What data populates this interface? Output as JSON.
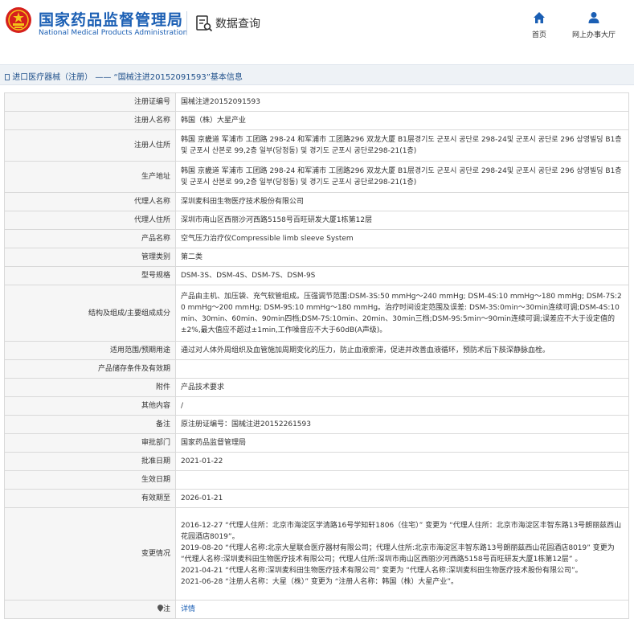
{
  "header": {
    "brand_cn": "国家药品监督管理局",
    "brand_en": "National Medical Products Administration",
    "query_title": "数据查询",
    "nav": {
      "home": "首页",
      "hall": "网上办事大厅"
    }
  },
  "breadcrumb": {
    "section": "进口医疗器械（注册）",
    "sep": " —— ",
    "record": "“国械注进20152091593”基本信息"
  },
  "rows": [
    {
      "key": "注册证编号",
      "value": "国械注进20152091593"
    },
    {
      "key": "注册人名称",
      "value": "韩国（株）大星产业"
    },
    {
      "key": "注册人住所",
      "value": "韩国 京畿道 军浦市 工团路 298-24 和军浦市 工团路296 双龙大厦 B1层경기도 군포시 공단로 298-24및 군포시 공단로 296 상영빌딩 B1층및 군포시 산본로 99,2층 일부(당정동) 및 경기도 군포시 공단로298-21(1층)"
    },
    {
      "key": "生产地址",
      "value": "韩国 京畿道 军浦市 工团路 298-24 和军浦市 工团路296 双龙大厦 B1层경기도 군포시 공단로 298-24및 군포시 공단로 296 상영빌딩 B1층및 군포시 산본로 99,2층 일부(당정동) 및 경기도 군포시 공단로298-21(1층)"
    },
    {
      "key": "代理人名称",
      "value": "深圳麦科田生物医疗技术股份有限公司"
    },
    {
      "key": "代理人住所",
      "value": "深圳市南山区西丽沙河西路5158号百旺研发大厦1栋第12层"
    },
    {
      "key": "产品名称",
      "value": "空气压力治疗仪Compressible limb sleeve System"
    },
    {
      "key": "管理类别",
      "value": "第二类"
    },
    {
      "key": "型号规格",
      "value": "DSM-3S、DSM-4S、DSM-7S、DSM-9S"
    },
    {
      "key": "结构及组成/主要组成成分",
      "value": "产品由主机、加压袋、充气软管组成。压强调节范围:DSM-3S:50 mmHg～240 mmHg; DSM-4S:10 mmHg～180 mmHg; DSM-7S:20 mmHg～200 mmHg; DSM-9S:10 mmHg～180 mmHg。治疗时间设定范围及误差: DSM-3S:0min～30min连续可调;DSM-4S:10min、30min、60min、90min四档;DSM-7S:10min、20min、30min三档;DSM-9S:5min～90min连续可调;误差应不大于设定值的±2%,最大值应不超过±1min,工作噪音应不大于60dB(A声级)。"
    },
    {
      "key": "适用范围/预期用途",
      "value": "通过对人体外周组织及血管施加周期变化的压力，防止血液瘀滞，促进并改善血液循环，预防术后下肢深静脉血栓。"
    },
    {
      "key": "产品储存条件及有效期",
      "value": ""
    },
    {
      "key": "附件",
      "value": "产品技术要求"
    },
    {
      "key": "其他内容",
      "value": "/"
    },
    {
      "key": "备注",
      "value": "原注册证编号：国械注进20152261593"
    },
    {
      "key": "审批部门",
      "value": "国家药品监督管理局"
    },
    {
      "key": "批准日期",
      "value": "2021-01-22"
    },
    {
      "key": "生效日期",
      "value": ""
    },
    {
      "key": "有效期至",
      "value": "2026-01-21"
    }
  ],
  "changes": {
    "key": "变更情况",
    "lines": [
      "2016-12-27 “代理人住所：北京市海淀区学清路16号学知轩1806（住宅）” 变更为 “代理人住所：北京市海淀区丰智东路13号朗丽兹西山花园酒店8019”。",
      "2019-08-20 “代理人名称:北京大星联合医疗器材有限公司；代理人住所:北京市海淀区丰智东路13号朗丽兹西山花园酒店8019” 变更为 “代理人名称:深圳麦科田生物医疗技术有限公司；代理人住所:深圳市南山区西丽沙河西路5158号百旺研发大厦1栋第12层” 。",
      "2021-04-21 “代理人名称:深圳麦科田生物医疗技术有限公司” 变更为 “代理人名称:深圳麦科田生物医疗技术股份有限公司”。",
      "2021-06-28 “注册人名称：大星（株）” 变更为 “注册人名称：韩国（株）大星产业”。"
    ]
  },
  "note": {
    "key": "注",
    "link": "详情"
  },
  "colors": {
    "brand_blue": "#1b5fb4",
    "key_bg": "#f6f6f6",
    "border": "#d9d9d9",
    "crumb_bg": "#eef2f6"
  }
}
